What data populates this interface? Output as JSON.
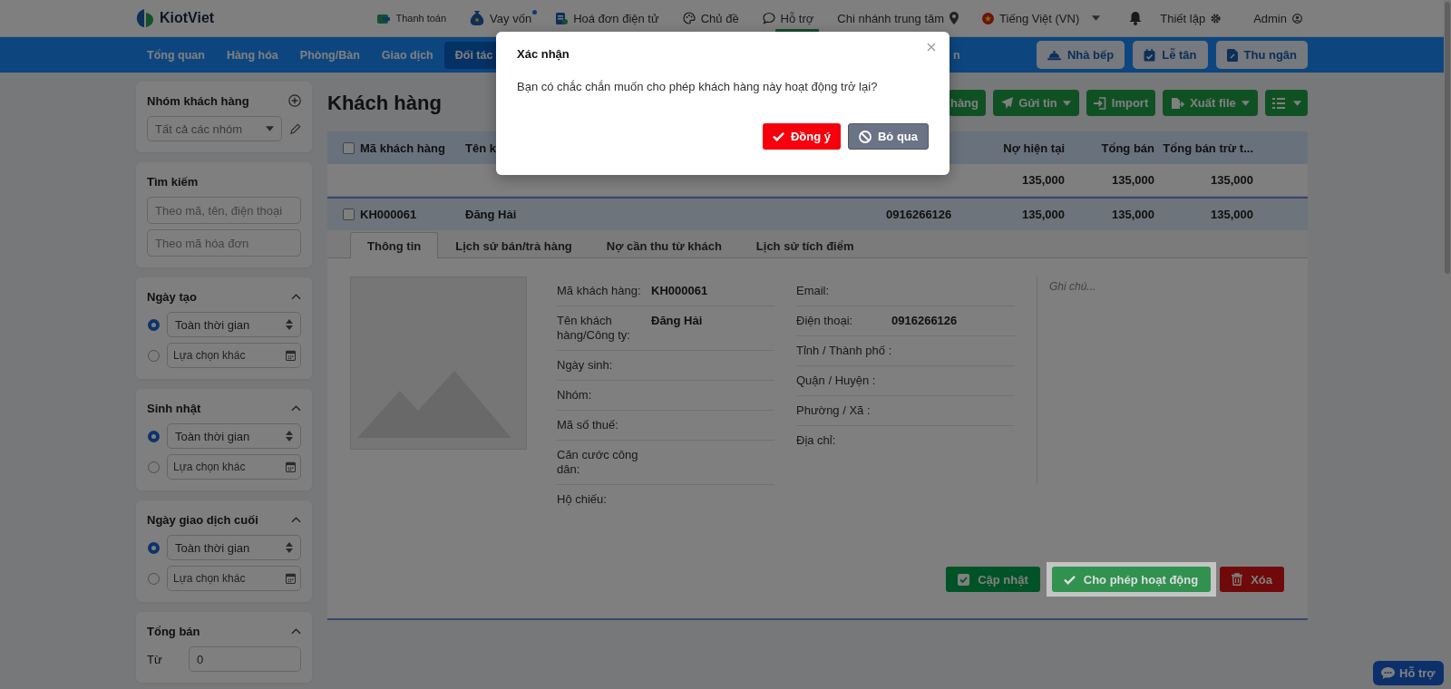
{
  "header": {
    "logo": "KiotViet",
    "links": [
      {
        "label": "Thanh toán",
        "dot": false,
        "tag": false
      },
      {
        "label": "Vay vốn",
        "dot": true,
        "tag": false
      },
      {
        "label": "Hoá đơn điện tử",
        "dot": false,
        "tag": false
      },
      {
        "label": "Chủ đề",
        "dot": false,
        "tag": false
      },
      {
        "label": "Hỗ trợ",
        "dot": false,
        "tag": true
      }
    ],
    "branch": "Chi nhánh trung tâm",
    "language": "Tiếng Việt (VN)",
    "settings": "Thiết lập",
    "user": "Admin"
  },
  "nav": {
    "items": [
      {
        "label": "Tổng quan",
        "selected": false
      },
      {
        "label": "Hàng hóa",
        "selected": false
      },
      {
        "label": "Phòng/Bàn",
        "selected": false
      },
      {
        "label": "Giao dịch",
        "selected": false
      },
      {
        "label": "Đối tác",
        "selected": true
      }
    ],
    "partial_item": "n",
    "buttons": [
      "Nhà bếp",
      "Lễ tân",
      "Thu ngân"
    ]
  },
  "sidebar": {
    "panels": [
      {
        "kind": "group",
        "title": "Nhóm khách hàng",
        "select": "Tất cả các nhóm"
      },
      {
        "kind": "search",
        "title": "Tìm kiếm",
        "fields": [
          {
            "placeholder": "Theo mã, tên, điện thoại"
          },
          {
            "placeholder": "Theo mã hóa đơn"
          }
        ]
      },
      {
        "kind": "date",
        "title": "Ngày tạo",
        "expanded": true,
        "options": [
          {
            "kind": "select",
            "value": "Toàn thời gian",
            "selected": true
          },
          {
            "kind": "date",
            "placeholder": "Lựa chọn khác",
            "selected": false
          }
        ]
      },
      {
        "kind": "date",
        "title": "Sinh nhật",
        "expanded": true,
        "options": [
          {
            "kind": "select",
            "value": "Toàn thời gian",
            "selected": true
          },
          {
            "kind": "date",
            "placeholder": "Lựa chọn khác",
            "selected": false
          }
        ]
      },
      {
        "kind": "date",
        "title": "Ngày giao dịch cuối",
        "expanded": true,
        "options": [
          {
            "kind": "select",
            "value": "Toàn thời gian",
            "selected": true
          },
          {
            "kind": "date",
            "placeholder": "Lựa chọn khác",
            "selected": false
          }
        ]
      },
      {
        "kind": "range",
        "title": "Tổng bán",
        "expanded": true,
        "from_label": "Từ",
        "from_value": "0"
      }
    ]
  },
  "page_title": "Khách hàng",
  "toolbar": [
    {
      "label": "hàng",
      "caret": false
    },
    {
      "label": "Gửi tin",
      "caret": true
    },
    {
      "label": "Import",
      "caret": false
    },
    {
      "label": "Xuất file",
      "caret": true
    }
  ],
  "table": {
    "all_checked": false,
    "columns": [
      "Mã khách hàng",
      "Tên k",
      "Nợ hiện tại",
      "Tổng bán",
      "Tổng bán trừ t..."
    ],
    "summary": [
      "135,000",
      "135,000",
      "135,000"
    ],
    "rows": [
      {
        "selected": true,
        "checked": false,
        "code": "KH000061",
        "name": "Đăng Hải",
        "phone": "0916266126",
        "debt": "135,000",
        "sales": "135,000",
        "net_sales": "135,000"
      }
    ]
  },
  "detail": {
    "tabs": [
      {
        "label": "Thông tin",
        "selected": true
      },
      {
        "label": "Lịch sử bán/trả hàng",
        "selected": false
      },
      {
        "label": "Nợ cần thu từ khách",
        "selected": false
      },
      {
        "label": "Lịch sử tích điểm",
        "selected": false
      }
    ],
    "left_fields": [
      {
        "label": "Mã khách hàng:",
        "value": "KH000061"
      },
      {
        "label": "Tên khách hàng/Công ty:",
        "value": "Đăng Hải"
      },
      {
        "label": "Ngày sinh:"
      },
      {
        "label": "Nhóm:"
      },
      {
        "label": "Mã số thuế:"
      },
      {
        "label": "Căn cước công dân:"
      },
      {
        "label": "Hộ chiếu:"
      }
    ],
    "right_fields": [
      {
        "label": "Email:"
      },
      {
        "label": "Điện thoại:",
        "value": "0916266126"
      },
      {
        "label": "Tỉnh / Thành phố :"
      },
      {
        "label": "Quận / Huyện :"
      },
      {
        "label": "Phường / Xã :"
      },
      {
        "label": "Địa chỉ:"
      }
    ],
    "note_placeholder": "Ghi chú...",
    "actions": [
      {
        "kind": "update",
        "label": "Cập nhật",
        "highlighted": false
      },
      {
        "kind": "activate",
        "label": "Cho phép hoạt động",
        "highlighted": true
      },
      {
        "kind": "delete",
        "label": "Xóa",
        "highlighted": false
      }
    ]
  },
  "help_button": "Hỗ trợ",
  "dialog": {
    "title": "Xác nhận",
    "message": "Bạn có chắc chắn muốn cho phép khách hàng này hoạt động trở lại?",
    "buttons": [
      {
        "kind": "confirm",
        "label": "Đồng ý"
      },
      {
        "kind": "cancel",
        "label": "Bỏ qua"
      }
    ]
  }
}
